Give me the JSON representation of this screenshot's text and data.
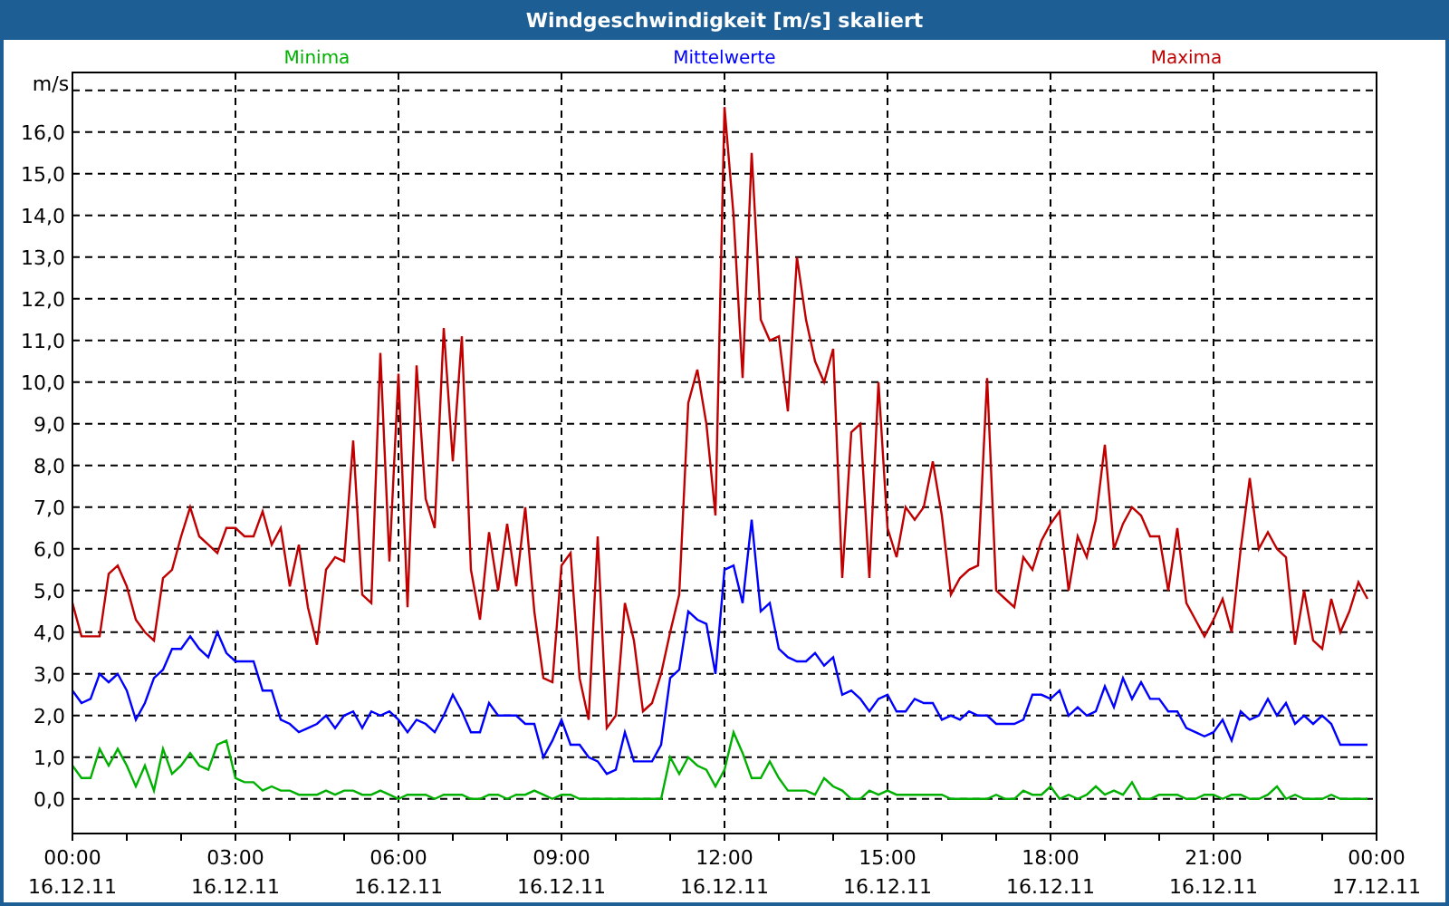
{
  "chart_data": {
    "type": "line",
    "title": "Windgeschwindigkeit [m/s] skaliert",
    "ylabel": "m/s",
    "grid": true,
    "ylim": [
      -0.83,
      17.43
    ],
    "categories": [
      "00:00\n16.12.11",
      null,
      null,
      null,
      null,
      null,
      null,
      null,
      null,
      null,
      null,
      null,
      null,
      null,
      null,
      null,
      null,
      null,
      "03:00\n16.12.11",
      null,
      null,
      null,
      null,
      null,
      null,
      null,
      null,
      null,
      null,
      null,
      null,
      null,
      null,
      null,
      null,
      null,
      "06:00\n16.12.11",
      null,
      null,
      null,
      null,
      null,
      null,
      null,
      null,
      null,
      null,
      null,
      null,
      null,
      null,
      null,
      null,
      null,
      "09:00\n16.12.11",
      null,
      null,
      null,
      null,
      null,
      null,
      null,
      null,
      null,
      null,
      null,
      null,
      null,
      null,
      null,
      null,
      null,
      "12:00\n16.12.11",
      null,
      null,
      null,
      null,
      null,
      null,
      null,
      null,
      null,
      null,
      null,
      null,
      null,
      null,
      null,
      null,
      null,
      "15:00\n16.12.11",
      null,
      null,
      null,
      null,
      null,
      null,
      null,
      null,
      null,
      null,
      null,
      null,
      null,
      null,
      null,
      null,
      null,
      "18:00\n16.12.11",
      null,
      null,
      null,
      null,
      null,
      null,
      null,
      null,
      null,
      null,
      null,
      null,
      null,
      null,
      null,
      null,
      null,
      "21:00\n16.12.11",
      null,
      null,
      null,
      null,
      null,
      null,
      null,
      null,
      null,
      null,
      null,
      null,
      null,
      null,
      null,
      null,
      null,
      "00:00\n17.12.11"
    ],
    "yticks": [
      {
        "value": 0,
        "label": "0,0"
      },
      {
        "value": 1,
        "label": "1,0"
      },
      {
        "value": 2,
        "label": "2,0"
      },
      {
        "value": 3,
        "label": "3,0"
      },
      {
        "value": 4,
        "label": "4,0"
      },
      {
        "value": 5,
        "label": "5,0"
      },
      {
        "value": 6,
        "label": "6,0"
      },
      {
        "value": 7,
        "label": "7,0"
      },
      {
        "value": 8,
        "label": "8,0"
      },
      {
        "value": 9,
        "label": "9,0"
      },
      {
        "value": 10,
        "label": "10,0"
      },
      {
        "value": 11,
        "label": "11,0"
      },
      {
        "value": 12,
        "label": "12,0"
      },
      {
        "value": 13,
        "label": "13,0"
      },
      {
        "value": 14,
        "label": "14,0"
      },
      {
        "value": 15,
        "label": "15,0"
      },
      {
        "value": 16,
        "label": "16,0"
      }
    ],
    "ref_lines": [
      {
        "axis": "y",
        "value": 17
      }
    ],
    "series": [
      {
        "name": "Minima",
        "color": "#00b000",
        "values": [
          0.8,
          0.5,
          0.5,
          1.2,
          0.8,
          1.2,
          0.8,
          0.3,
          0.8,
          0.2,
          1.2,
          0.6,
          0.8,
          1.1,
          0.8,
          0.7,
          1.3,
          1.4,
          0.5,
          0.4,
          0.4,
          0.2,
          0.3,
          0.2,
          0.2,
          0.1,
          0.1,
          0.1,
          0.2,
          0.1,
          0.2,
          0.2,
          0.1,
          0.1,
          0.2,
          0.1,
          0.0,
          0.1,
          0.1,
          0.1,
          0.0,
          0.1,
          0.1,
          0.1,
          0.0,
          0.0,
          0.1,
          0.1,
          0.0,
          0.1,
          0.1,
          0.2,
          0.1,
          0.0,
          0.1,
          0.1,
          0.0,
          0.0,
          0.0,
          0.0,
          0.0,
          0.0,
          0.0,
          0.0,
          0.0,
          0.0,
          1.0,
          0.6,
          1.0,
          0.8,
          0.7,
          0.3,
          0.7,
          1.6,
          1.1,
          0.5,
          0.5,
          0.9,
          0.5,
          0.2,
          0.2,
          0.2,
          0.1,
          0.5,
          0.3,
          0.2,
          0.0,
          0.0,
          0.2,
          0.1,
          0.2,
          0.1,
          0.1,
          0.1,
          0.1,
          0.1,
          0.1,
          0.0,
          0.0,
          0.0,
          0.0,
          0.0,
          0.1,
          0.0,
          0.0,
          0.2,
          0.1,
          0.1,
          0.3,
          0.0,
          0.1,
          0.0,
          0.1,
          0.3,
          0.1,
          0.2,
          0.1,
          0.4,
          0.0,
          0.0,
          0.1,
          0.1,
          0.1,
          0.0,
          0.0,
          0.1,
          0.1,
          0.0,
          0.1,
          0.1,
          0.0,
          0.0,
          0.1,
          0.3,
          0.0,
          0.1,
          0.0,
          0.0,
          0.0,
          0.1,
          0.0,
          0.0,
          0.0,
          0.0,
          null
        ]
      },
      {
        "name": "Mittelwerte",
        "color": "#0000ff",
        "values": [
          2.6,
          2.3,
          2.4,
          3.0,
          2.8,
          3.0,
          2.6,
          1.9,
          2.3,
          2.9,
          3.1,
          3.6,
          3.6,
          3.9,
          3.6,
          3.4,
          4.0,
          3.5,
          3.3,
          3.3,
          3.3,
          2.6,
          2.6,
          1.9,
          1.8,
          1.6,
          1.7,
          1.8,
          2.0,
          1.7,
          2.0,
          2.1,
          1.7,
          2.1,
          2.0,
          2.1,
          1.9,
          1.6,
          1.9,
          1.8,
          1.6,
          2.0,
          2.5,
          2.1,
          1.6,
          1.6,
          2.3,
          2.0,
          2.0,
          2.0,
          1.8,
          1.8,
          1.0,
          1.4,
          1.9,
          1.3,
          1.3,
          1.0,
          0.9,
          0.6,
          0.7,
          1.6,
          0.9,
          0.9,
          0.9,
          1.3,
          2.9,
          3.1,
          4.5,
          4.3,
          4.2,
          3.0,
          5.5,
          5.6,
          4.7,
          6.7,
          4.5,
          4.7,
          3.6,
          3.4,
          3.3,
          3.3,
          3.5,
          3.2,
          3.4,
          2.5,
          2.6,
          2.4,
          2.1,
          2.4,
          2.5,
          2.1,
          2.1,
          2.4,
          2.3,
          2.3,
          1.9,
          2.0,
          1.9,
          2.1,
          2.0,
          2.0,
          1.8,
          1.8,
          1.8,
          1.9,
          2.5,
          2.5,
          2.4,
          2.6,
          2.0,
          2.2,
          2.0,
          2.1,
          2.7,
          2.2,
          2.9,
          2.4,
          2.8,
          2.4,
          2.4,
          2.1,
          2.1,
          1.7,
          1.6,
          1.5,
          1.6,
          1.9,
          1.4,
          2.1,
          1.9,
          2.0,
          2.4,
          2.0,
          2.3,
          1.8,
          2.0,
          1.8,
          2.0,
          1.8,
          1.3,
          1.3,
          1.3,
          1.3,
          null
        ]
      },
      {
        "name": "Maxima",
        "color": "#c00000",
        "values": [
          4.7,
          3.9,
          3.9,
          3.9,
          5.4,
          5.6,
          5.1,
          4.3,
          4.0,
          3.8,
          5.3,
          5.5,
          6.3,
          7.0,
          6.3,
          6.1,
          5.9,
          6.5,
          6.5,
          6.3,
          6.3,
          6.9,
          6.1,
          6.5,
          5.1,
          6.1,
          4.6,
          3.7,
          5.5,
          5.8,
          5.7,
          8.6,
          4.9,
          4.7,
          10.7,
          5.7,
          10.2,
          4.6,
          10.4,
          7.2,
          6.5,
          11.3,
          8.1,
          11.1,
          5.5,
          4.3,
          6.4,
          5.0,
          6.6,
          5.1,
          7.0,
          4.5,
          2.9,
          2.8,
          5.6,
          5.9,
          2.9,
          1.9,
          6.3,
          1.7,
          2.0,
          4.7,
          3.8,
          2.1,
          2.3,
          3.0,
          4.0,
          4.9,
          9.5,
          10.3,
          9.0,
          6.8,
          16.6,
          14.0,
          10.1,
          15.5,
          11.5,
          11.0,
          11.1,
          9.3,
          13.0,
          11.5,
          10.5,
          10.0,
          10.8,
          5.3,
          8.8,
          9.0,
          5.3,
          10.0,
          6.5,
          5.8,
          7.0,
          6.7,
          7.0,
          8.1,
          6.8,
          4.9,
          5.3,
          5.5,
          5.6,
          10.1,
          5.0,
          4.8,
          4.6,
          5.8,
          5.5,
          6.2,
          6.6,
          6.9,
          5.0,
          6.3,
          5.8,
          6.7,
          8.5,
          6.0,
          6.6,
          7.0,
          6.8,
          6.3,
          6.3,
          5.0,
          6.5,
          4.7,
          4.3,
          3.9,
          4.3,
          4.8,
          4.0,
          6.0,
          7.7,
          6.0,
          6.4,
          6.0,
          5.8,
          3.7,
          5.0,
          3.8,
          3.6,
          4.8,
          4.0,
          4.5,
          5.2,
          4.8,
          null
        ]
      }
    ]
  }
}
